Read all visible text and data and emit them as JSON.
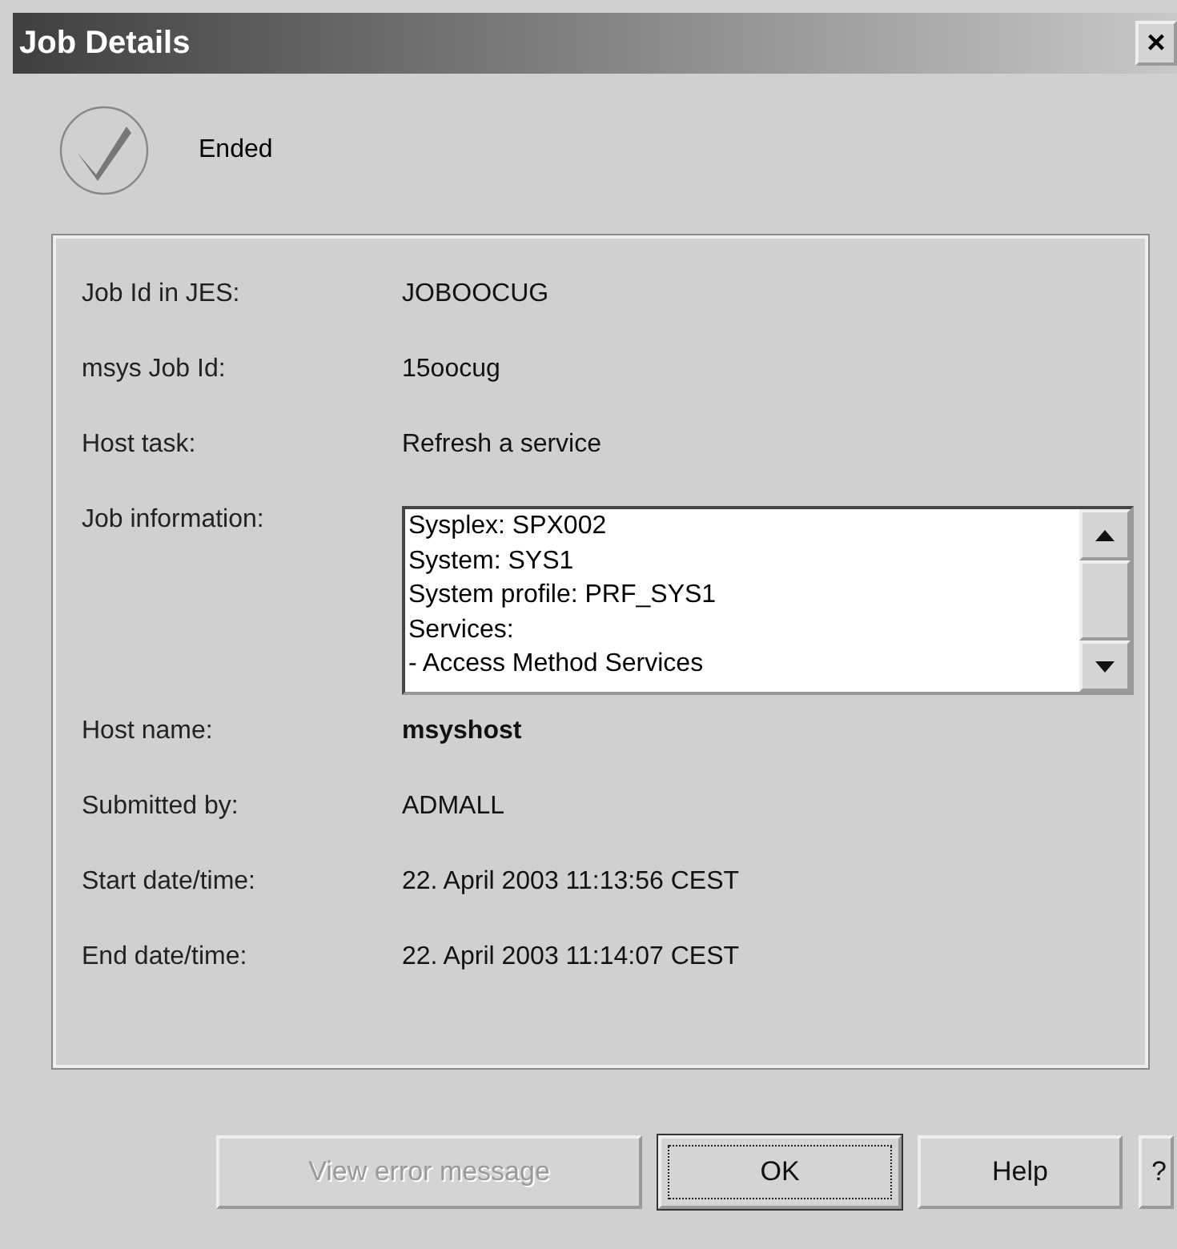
{
  "window": {
    "title": "Job Details",
    "close": "×"
  },
  "status": {
    "text": "Ended"
  },
  "fields": [
    {
      "kind": "text",
      "label": "Job Id in JES:",
      "value": "JOBOOCUG",
      "bold": false
    },
    {
      "kind": "text",
      "label": "msys Job Id:",
      "value": "15oocug",
      "bold": false
    },
    {
      "kind": "text",
      "label": "Host task:",
      "value": "Refresh a service",
      "bold": false
    },
    {
      "kind": "list",
      "label": "Job information:",
      "lines": [
        "Sysplex: SPX002",
        "System: SYS1",
        "System profile: PRF_SYS1",
        "Services:",
        "- Access Method Services"
      ]
    },
    {
      "kind": "text",
      "label": "Host name:",
      "value": "msyshost",
      "bold": true
    },
    {
      "kind": "text",
      "label": "Submitted by:",
      "value": "ADMALL",
      "bold": false
    },
    {
      "kind": "text",
      "label": "Start date/time:",
      "value": "22. April 2003 11:13:56 CEST",
      "bold": false
    },
    {
      "kind": "text",
      "label": "End date/time:",
      "value": "22. April 2003 11:14:07 CEST",
      "bold": false
    }
  ],
  "buttons": [
    {
      "label": "View error message",
      "disabled": true,
      "focused": false
    },
    {
      "label": "OK",
      "disabled": false,
      "focused": true
    },
    {
      "label": "Help",
      "disabled": false,
      "focused": false
    },
    {
      "label": "?",
      "disabled": false,
      "focused": false
    }
  ]
}
